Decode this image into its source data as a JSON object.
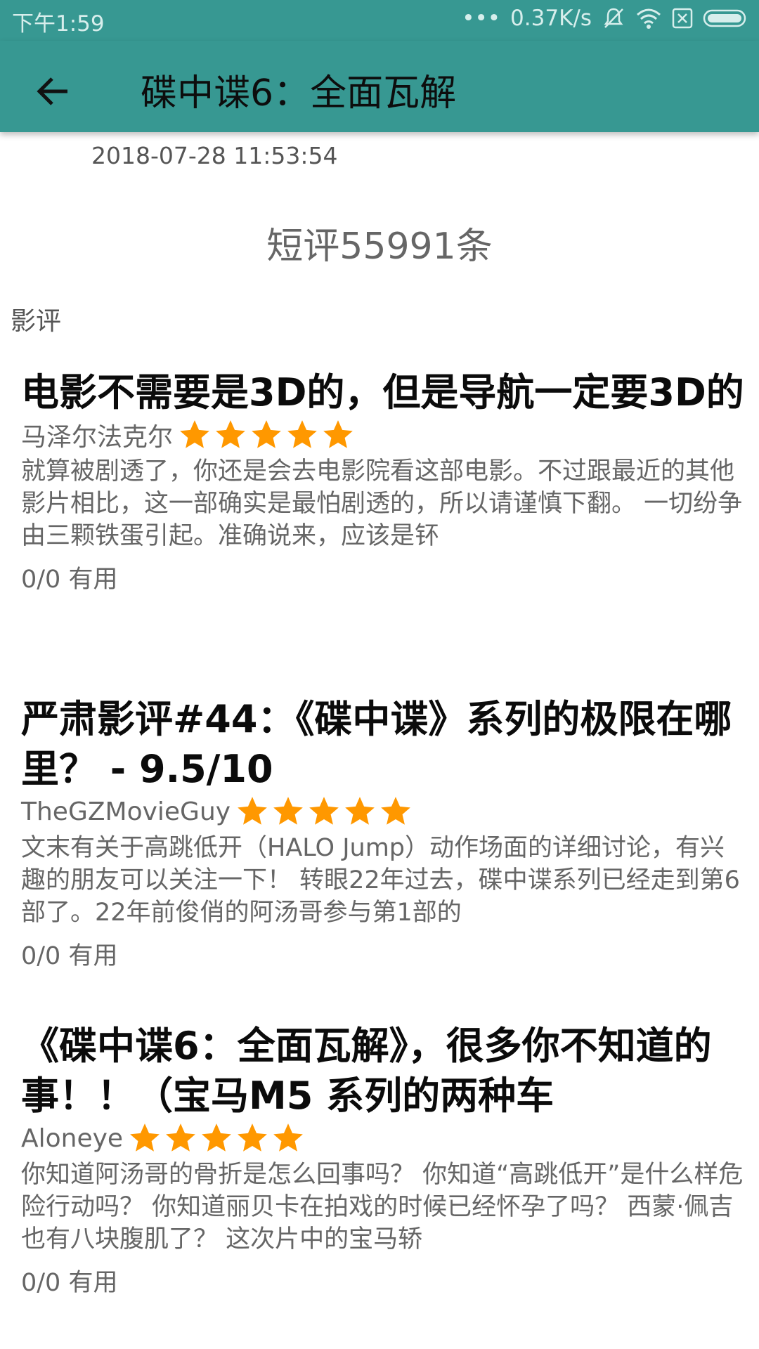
{
  "status": {
    "time": "下午1:59",
    "dots": "•••",
    "speed": "0.37K/s"
  },
  "appbar": {
    "title": "碟中谍6：全面瓦解",
    "back_icon": "arrow-left-icon"
  },
  "header": {
    "timestamp": "2018-07-28 11:53:54",
    "short_review_count": "短评55991条",
    "section_label": "影评"
  },
  "colors": {
    "accent": "#379892",
    "star": "#ff9800"
  },
  "reviews": [
    {
      "title": "电影不需要是3D的，但是导航一定要3D的",
      "author": "马泽尔法克尔",
      "stars": 5,
      "body": "就算被剧透了，你还是会去电影院看这部电影。不过跟最近的其他影片相比，这一部确实是最怕剧透的，所以请谨慎下翻。 一切纷争由三颗铁蛋引起。准确说来，应该是钚",
      "useful": "0/0 有用"
    },
    {
      "title": "严肃影评#44：《碟中谍》系列的极限在哪里？ - 9.5/10",
      "author": "TheGZMovieGuy",
      "stars": 5,
      "body": "文末有关于高跳低开（HALO Jump）动作场面的详细讨论，有兴趣的朋友可以关注一下！ 转眼22年过去，碟中谍系列已经走到第6部了。22年前俊俏的阿汤哥参与第1部的",
      "useful": "0/0 有用"
    },
    {
      "title": "《碟中谍6：全面瓦解》，很多你不知道的事！！（宝马M5 系列的两种车",
      "author": "Aloneye",
      "stars": 5,
      "body": "你知道阿汤哥的骨折是怎么回事吗？ 你知道“高跳低开”是什么样危险行动吗？ 你知道丽贝卡在拍戏的时候已经怀孕了吗？ 西蒙·佩吉也有八块腹肌了？ 这次片中的宝马轿",
      "useful": "0/0 有用"
    }
  ]
}
